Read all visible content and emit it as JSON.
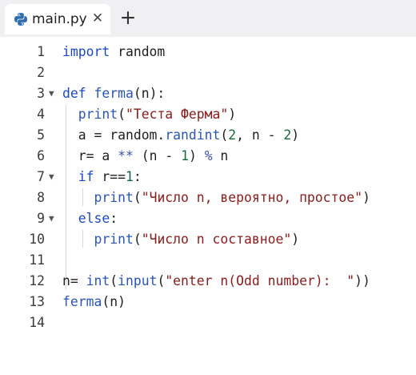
{
  "tab": {
    "filename": "main.py",
    "close_glyph": "✕",
    "icon": "python-icon"
  },
  "add_tab_glyph": "+",
  "editor": {
    "line_numbers": [
      "1",
      "2",
      "3",
      "4",
      "5",
      "6",
      "7",
      "8",
      "9",
      "10",
      "11",
      "12",
      "13",
      "14"
    ],
    "fold_glyph": "▼",
    "code": {
      "l1": [
        "import",
        " random"
      ],
      "l3": [
        "def",
        " ",
        "ferma",
        "(n):"
      ],
      "l4": [
        "print",
        "(",
        "\"Теста Ферма\"",
        ")"
      ],
      "l5": [
        "a = random.",
        "randint",
        "(",
        "2",
        ", n - ",
        "2",
        ")"
      ],
      "l6": [
        "r= a ",
        "**",
        " (n - ",
        "1",
        ") ",
        "%",
        " n"
      ],
      "l7": [
        "if",
        " r==",
        "1",
        ":"
      ],
      "l8": [
        "print",
        "(",
        "\"Число n, вероятно, простое\"",
        ")"
      ],
      "l9": [
        "else",
        ":"
      ],
      "l10": [
        "print",
        "(",
        "\"Число n составное\"",
        ")"
      ],
      "l12": [
        "n= ",
        "int",
        "(",
        "input",
        "(",
        "\"enter n(Odd number):  \"",
        "))"
      ],
      "l13": [
        "ferma",
        "(n)"
      ]
    }
  },
  "colors": {
    "keyword": "#1c49c8",
    "string": "#8c1b1b",
    "number": "#146a3e",
    "tabbar_bg": "#f0f0f2"
  }
}
